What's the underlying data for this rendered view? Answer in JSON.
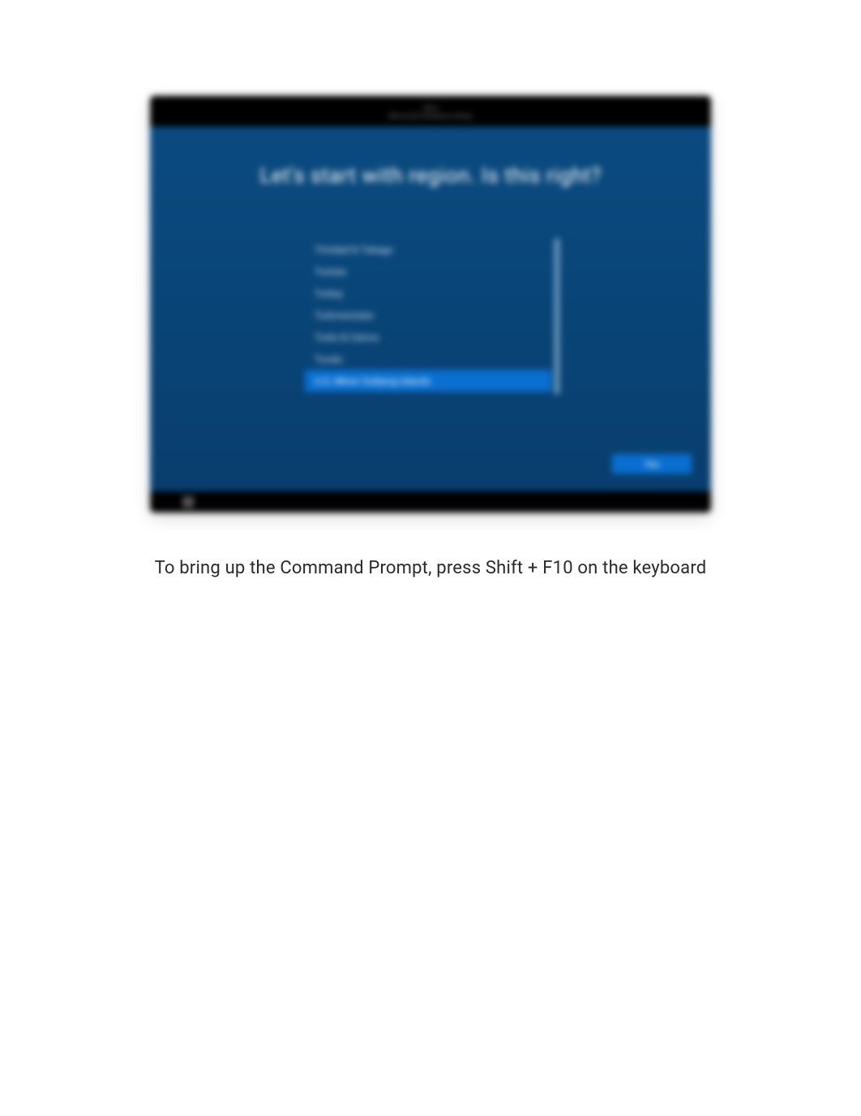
{
  "caption": "To bring up the Command Prompt, press Shift + F10 on the keyboard",
  "oobe": {
    "titlebar_line1": "Setup",
    "titlebar_line2": "Microsoft Windows Setup",
    "heading": "Let's start with region. Is this right?",
    "regions": [
      "Trinidad & Tobago",
      "Tunisia",
      "Turkey",
      "Turkmenistan",
      "Turks & Caicos",
      "Tuvalu",
      "U.S. Minor Outlying Islands"
    ],
    "selected_index": 6,
    "yes_label": "Yes"
  }
}
